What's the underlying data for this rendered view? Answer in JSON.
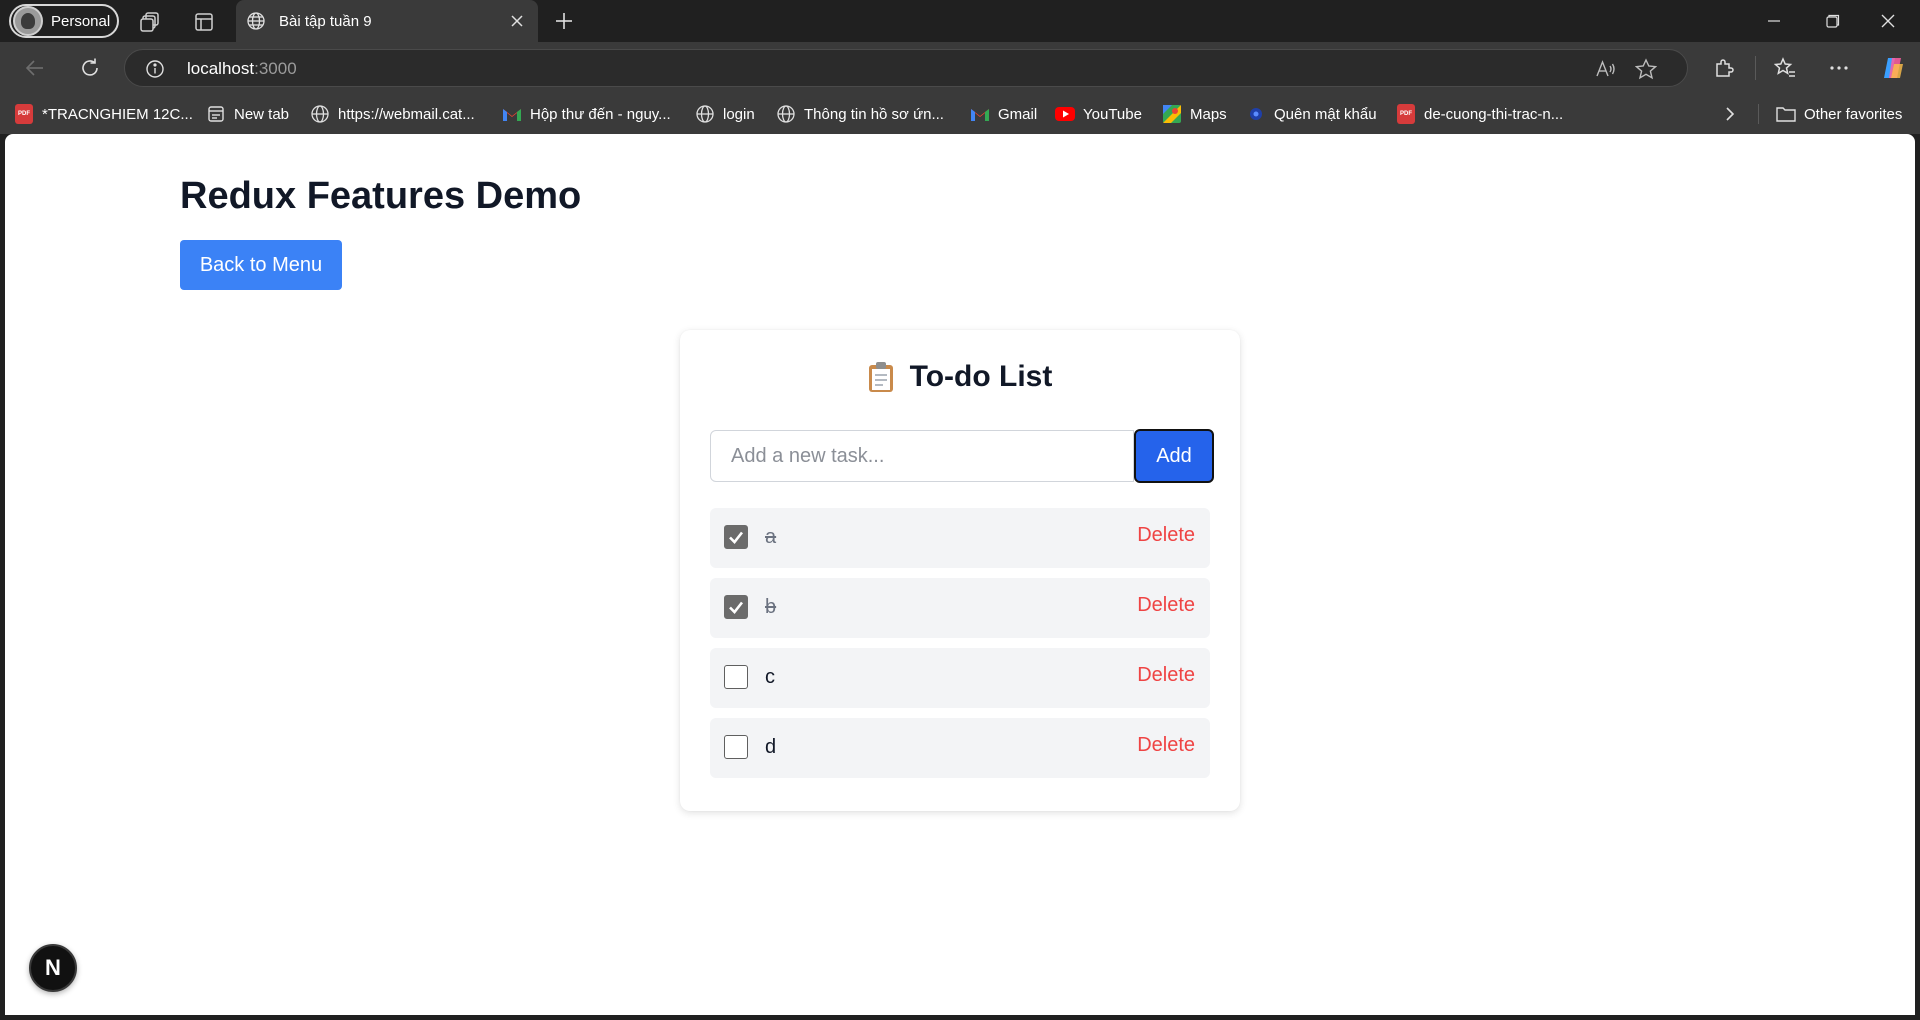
{
  "browser": {
    "profile_label": "Personal",
    "tab_title": "Bài tập tuần 9",
    "url_host": "localhost",
    "url_port": ":3000"
  },
  "bookmarks": [
    {
      "label": "*TRACNGHIEM 12C...",
      "icon": "pdf-icon"
    },
    {
      "label": "New tab",
      "icon": "new-tab-icon"
    },
    {
      "label": "https://webmail.cat...",
      "icon": "globe-icon"
    },
    {
      "label": "Hộp thư đến - nguy...",
      "icon": "gmail-icon"
    },
    {
      "label": "login",
      "icon": "globe-icon"
    },
    {
      "label": "Thông tin hồ sơ ứn...",
      "icon": "globe-icon"
    },
    {
      "label": "Gmail",
      "icon": "gmail-icon"
    },
    {
      "label": "YouTube",
      "icon": "youtube-icon"
    },
    {
      "label": "Maps",
      "icon": "maps-icon"
    },
    {
      "label": "Quên mật khẩu",
      "icon": "site-icon"
    },
    {
      "label": "de-cuong-thi-trac-n...",
      "icon": "pdf-icon"
    }
  ],
  "other_favorites": "Other favorites",
  "page": {
    "title": "Redux Features Demo",
    "back_button": "Back to Menu"
  },
  "todo": {
    "title": "To-do List",
    "input_placeholder": "Add a new task...",
    "add_button": "Add",
    "items": [
      {
        "text": "a",
        "done": true,
        "delete_label": "Delete"
      },
      {
        "text": "b",
        "done": true,
        "delete_label": "Delete"
      },
      {
        "text": "c",
        "done": false,
        "delete_label": "Delete"
      },
      {
        "text": "d",
        "done": false,
        "delete_label": "Delete"
      }
    ]
  },
  "dev_badge": "N",
  "colors": {
    "primary": "#3b82f6",
    "add_button": "#2563eb",
    "delete": "#ef4444",
    "item_bg": "#f3f4f6"
  }
}
